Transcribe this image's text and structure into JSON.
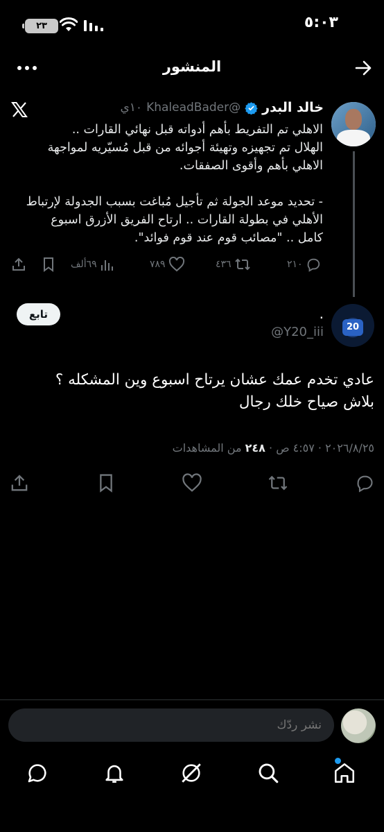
{
  "status_bar": {
    "time": "٥:٠٣",
    "battery": "٢٣"
  },
  "header": {
    "title": "المنشور"
  },
  "quoted_tweet": {
    "name": "خالد البدر",
    "handle": "@KhaleadBader",
    "time": "١٠ي",
    "body": "الاهلي تم التفريط بأهم أدواته قبل نهائي القارات ..\nالهلال تم تجهيزه وتهيئة أجوائه من قبل مُسيّريه لمواجهة الاهلي بأهم وأقوى الصفقات.\n\n- تحديد موعد الجولة ثم تأجيل مُباغت بسبب الجدولة لإرتباط الأهلي في بطولة القارات .. ارتاح الفريق الأزرق اسبوع كامل .. \"مصائب قوم عند قوم فوائد\".",
    "replies": "٢١٠",
    "retweets": "٤٣٦",
    "likes": "٧٨٩",
    "views": "٦٩ألف"
  },
  "main_tweet": {
    "display_name": ".",
    "handle": "@Y20_iii",
    "follow_label": "تابع",
    "body": "عادي تخدم عمك عشان يرتاح اسبوع وين المشكله ؟\nبلاش صياح خلك رجال",
    "time": "٤:٥٧ ص",
    "date": "٢٠٢٦/٨/٢٥",
    "views_count": "٢٤٨",
    "views_label": "من المشاهدات"
  },
  "reply_bar": {
    "placeholder": "نشر ردّك"
  },
  "colors": {
    "accent": "#1d9bf0",
    "muted": "#71767b",
    "background": "#000000"
  }
}
